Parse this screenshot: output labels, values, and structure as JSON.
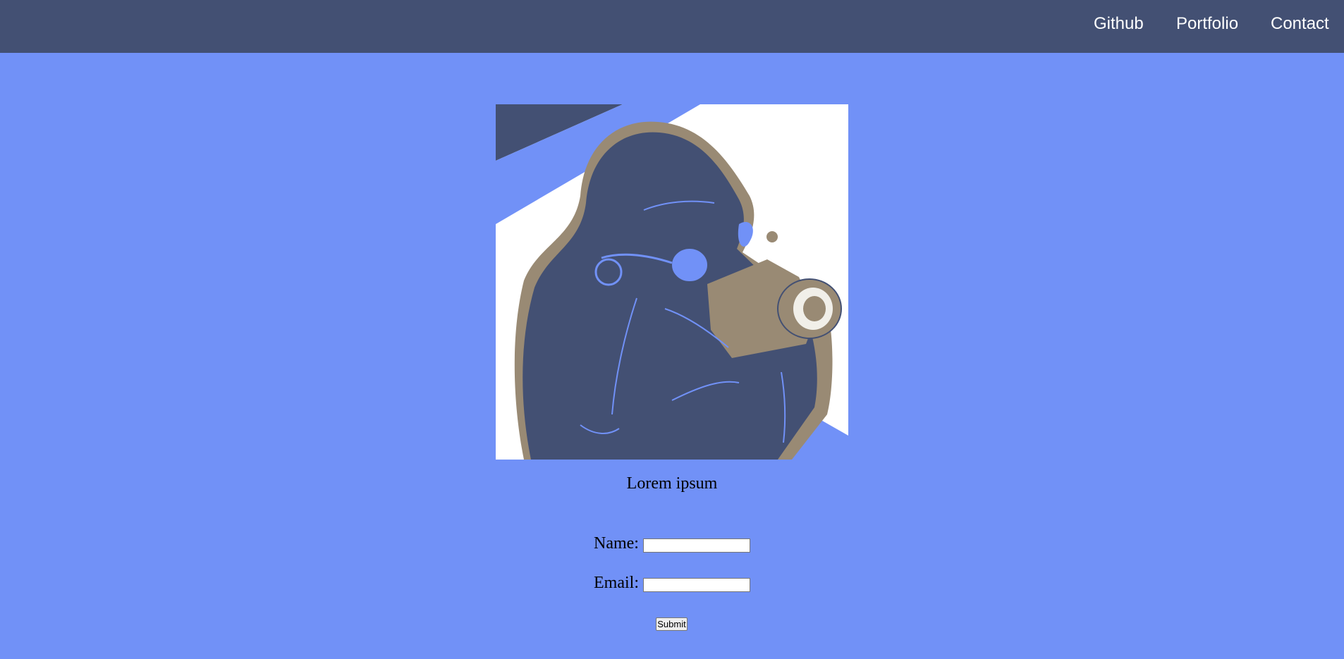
{
  "nav": {
    "links": [
      {
        "label": "Github"
      },
      {
        "label": "Portfolio"
      },
      {
        "label": "Contact"
      }
    ]
  },
  "hero": {
    "caption": "Lorem ipsum",
    "image_icon": "photographer-illustration"
  },
  "form": {
    "name_label": "Name:",
    "name_value": "",
    "email_label": "Email:",
    "email_value": "",
    "submit_label": "Submit"
  },
  "colors": {
    "page_background": "#7191f7",
    "navbar_background": "#435073",
    "illustration_dark": "#435073",
    "illustration_tan": "#998a74",
    "illustration_blue": "#7191f7",
    "illustration_white": "#ffffff"
  }
}
